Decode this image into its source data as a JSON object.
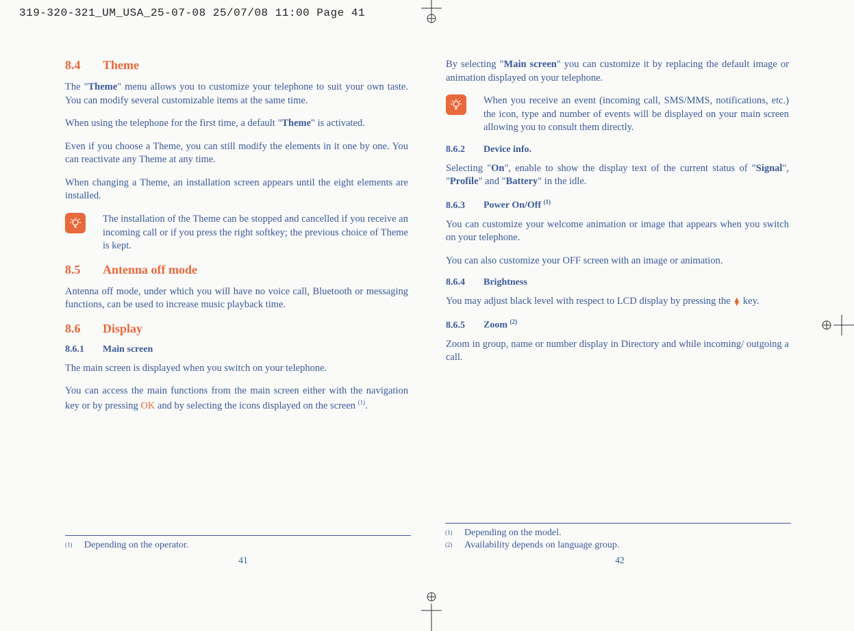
{
  "print_header": "319-320-321_UM_USA_25-07-08  25/07/08  11:00  Page 41",
  "left": {
    "s84": {
      "num": "8.4",
      "title": "Theme"
    },
    "p1a": "The \"",
    "p1b": "Theme",
    "p1c": "\" menu allows you to customize your telephone to suit your own taste. You can modify several customizable items at the same time.",
    "p2a": "When using the telephone for the first time, a default \"",
    "p2b": "Theme",
    "p2c": "\" is activated.",
    "p3": "Even if you choose a Theme, you can still modify the elements in it one by one. You can reactivate any Theme at any time.",
    "p4": "When changing a Theme, an installation screen appears until the eight elements are installed.",
    "tip1": "The installation of the Theme can be stopped and cancelled if you receive an incoming call or if you press the right softkey; the previous choice of Theme is kept.",
    "s85": {
      "num": "8.5",
      "title": "Antenna off mode"
    },
    "p5": "Antenna off mode, under which you will have no voice call, Bluetooth or messaging functions, can be used to increase music playback time.",
    "s86": {
      "num": "8.6",
      "title": "Display"
    },
    "s861": {
      "num": "8.6.1",
      "title": "Main screen"
    },
    "p6": "The main screen is displayed when you switch on your telephone.",
    "p7a": "You can access the main functions from the main screen either with the navigation key or by pressing ",
    "p7b": "OK",
    "p7c": " and by selecting the icons displayed on the screen ",
    "p7d": "(1)",
    "p7e": ".",
    "fn1_mark": "(1)",
    "fn1_text": "Depending on the operator.",
    "pagenum": "41"
  },
  "right": {
    "p1a": "By selecting \"",
    "p1b": "Main screen",
    "p1c": "\" you can customize it by replacing the default image or animation displayed on your telephone.",
    "tip1": "When you receive an event (incoming call, SMS/MMS, notifications, etc.) the icon, type and number of events will be displayed on your main screen allowing you to consult them directly.",
    "s862": {
      "num": "8.6.2",
      "title": "Device info."
    },
    "p2a": "Selecting \"",
    "p2b": "On",
    "p2c": "\", enable to show the display text of the current status of \"",
    "p2d": "Signal",
    "p2e": "\",  \"",
    "p2f": "Profile",
    "p2g": "\" and \"",
    "p2h": "Battery",
    "p2i": "\" in the idle.",
    "s863": {
      "num": "8.6.3",
      "title": "Power On/Off ",
      "sup": "(1)"
    },
    "p3": "You can customize your welcome animation or image that appears when you switch on your telephone.",
    "p4": "You can also customize your OFF screen with an image or animation.",
    "s864": {
      "num": "8.6.4",
      "title": "Brightness"
    },
    "p5a": "You may adjust black level with respect to LCD display by pressing the ",
    "p5b": " key.",
    "s865": {
      "num": "8.6.5",
      "title": "Zoom ",
      "sup": "(2)"
    },
    "p6": "Zoom in group, name or number display in Directory and while incoming/ outgoing a call.",
    "fn1_mark": "(1)",
    "fn1_text": "Depending on the model.",
    "fn2_mark": "(2)",
    "fn2_text": "Availability depends on language group.",
    "pagenum": "42"
  }
}
